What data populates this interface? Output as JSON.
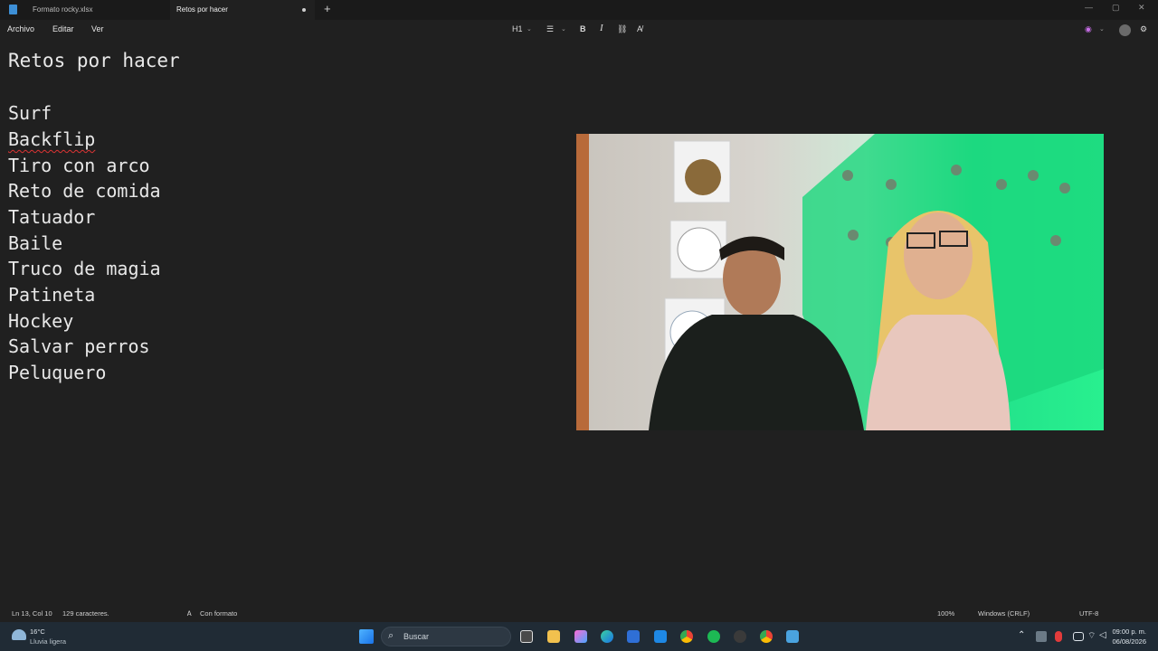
{
  "tabs": [
    {
      "label": "Formato rocky.xlsx"
    },
    {
      "label": "Retos por hacer"
    }
  ],
  "menu": {
    "archivo": "Archivo",
    "editar": "Editar",
    "ver": "Ver"
  },
  "toolbar": {
    "heading": "H1",
    "bold": "B",
    "italic": "I"
  },
  "document": {
    "title": "Retos por hacer",
    "lines": [
      "Surf",
      "Backflip",
      "Tiro con arco",
      "Reto de comida",
      "Tatuador",
      "Baile",
      "Truco de magia",
      "Patineta",
      "Hockey",
      "Salvar perros",
      "Peluquero"
    ]
  },
  "status": {
    "position": "Ln 13, Col 10",
    "chars": "129 caracteres.",
    "format": "Con formato",
    "zoom": "100%",
    "line_ending": "Windows (CRLF)",
    "encoding": "UTF-8"
  },
  "taskbar": {
    "weather_temp": "16°C",
    "weather_desc": "Lluvia ligera",
    "search_placeholder": "Buscar",
    "time": "09:00 p. m.",
    "date": "06/08/2026"
  },
  "colors": {
    "accent": "#3d8fd6",
    "background": "#202020",
    "webcam_green": "#28f08f"
  }
}
